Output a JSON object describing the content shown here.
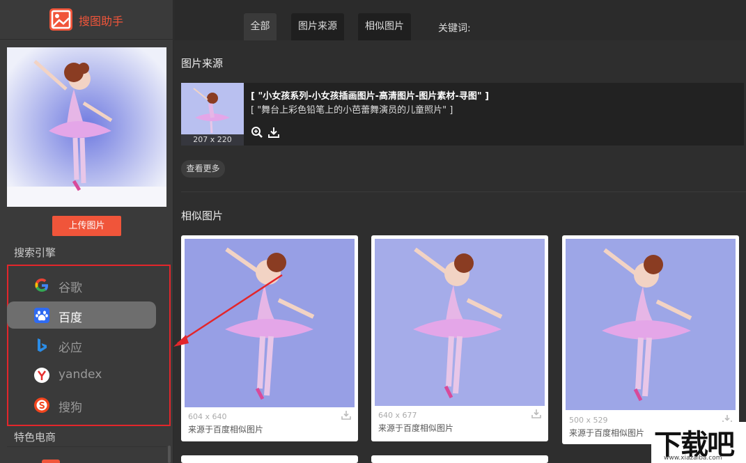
{
  "app": {
    "title": "搜图助手"
  },
  "sidebar": {
    "upload_label": "上传图片",
    "engines_heading": "搜索引擎",
    "engines": [
      {
        "label": "谷歌",
        "icon": "google-icon",
        "active": false
      },
      {
        "label": "百度",
        "icon": "baidu-icon",
        "active": true
      },
      {
        "label": "必应",
        "icon": "bing-icon",
        "active": false
      },
      {
        "label": "yandex",
        "icon": "yandex-icon",
        "active": false
      },
      {
        "label": "搜狗",
        "icon": "sogou-icon",
        "active": false
      }
    ],
    "ecommerce_heading": "特色电商"
  },
  "tabs": [
    {
      "label": "全部",
      "active": true
    },
    {
      "label": "图片来源",
      "active": false
    },
    {
      "label": "相似图片",
      "active": false
    }
  ],
  "keyword_label": "关键词:",
  "source_section": {
    "heading": "图片来源",
    "item": {
      "title": "[ \"小女孩系列-小女孩插画图片-高清图片-图片素材-寻图\" ]",
      "description": "[ \"舞台上彩色铅笔上的小芭蕾舞演员的儿童照片\" ]",
      "dimensions": "207 x 220"
    },
    "more_label": "查看更多"
  },
  "similar_section": {
    "heading": "相似图片",
    "items": [
      {
        "dimensions": "604 x 640",
        "source": "来源于百度相似图片"
      },
      {
        "dimensions": "640 x 677",
        "source": "来源于百度相似图片"
      },
      {
        "dimensions": "500 x 529",
        "source": "来源于百度相似图片"
      }
    ]
  },
  "watermark": {
    "text": "下载吧",
    "url": "www.xiazaiba.com"
  },
  "colors": {
    "accent": "#f0553a",
    "annotation": "#e3262b",
    "active_engine": "#6e6e6e"
  }
}
